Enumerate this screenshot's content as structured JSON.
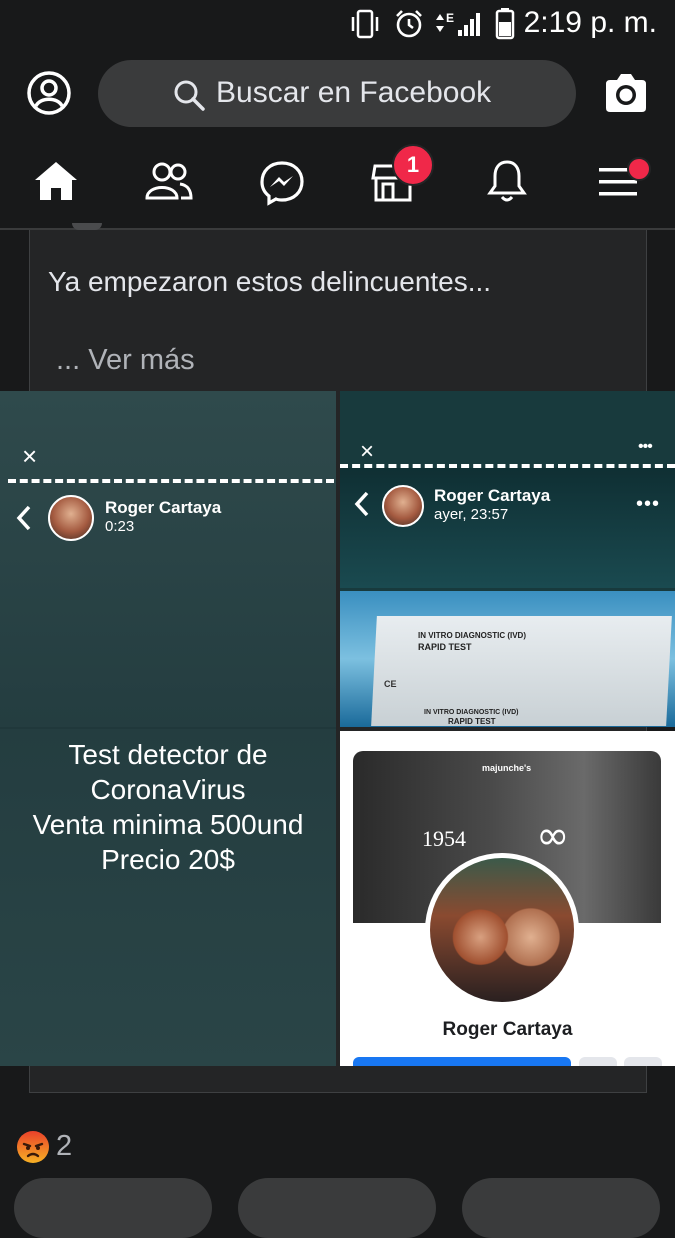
{
  "status_bar": {
    "time": "2:19 p. m.",
    "network": "E"
  },
  "header": {
    "search_placeholder": "Buscar en Facebook"
  },
  "nav": {
    "marketplace_badge": "1"
  },
  "post": {
    "text": "Ya empezaron estos delincuentes...",
    "see_more": "... Ver más",
    "images": {
      "left": {
        "close": "×",
        "name": "Roger Cartaya",
        "time": "0:23",
        "lines": [
          "Test detector de",
          "CoronaVirus",
          "Venta minima 500und",
          "Precio 20$"
        ]
      },
      "right_top": {
        "close": "×",
        "name": "Roger Cartaya",
        "time": "ayer, 23:57",
        "box_line1": "IN VITRO DIAGNOSTIC (IVD)",
        "box_line2": "RAPID TEST",
        "box_ce": "CE",
        "box_bottom1": "IN VITRO DIAGNOSTIC (IVD)",
        "box_bottom2": "RAPID TEST"
      },
      "right_bottom": {
        "logo": "majunche's",
        "year": "1954",
        "infinity": "∞",
        "name": "Roger Cartaya"
      }
    },
    "reaction_count": "2"
  },
  "colors": {
    "background": "#18191a",
    "card": "#242526",
    "accent": "#1877f2",
    "badge": "#f02849"
  }
}
